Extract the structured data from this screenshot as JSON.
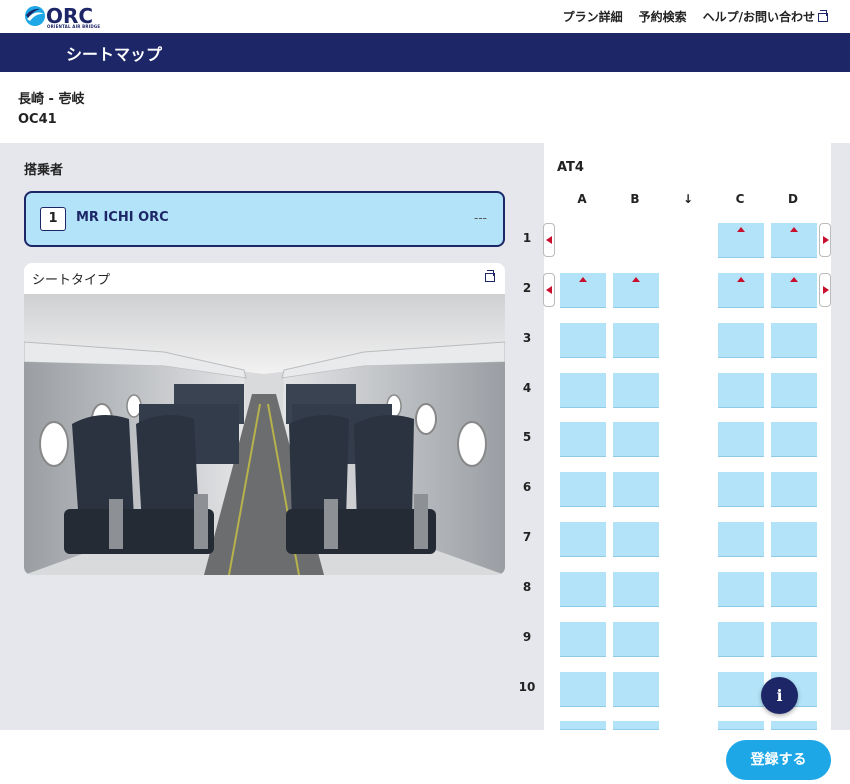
{
  "header": {
    "logo_text": "ORC",
    "logo_sub": "ORIENTAL AIR BRIDGE",
    "nav": [
      "プラン詳細",
      "予約検索",
      "ヘルプ/お問い合わせ"
    ]
  },
  "page": {
    "title": "シートマップ"
  },
  "route": {
    "segment": "長崎 - 壱岐",
    "flight": "OC41"
  },
  "passengers": {
    "title": "搭乗者",
    "list": [
      {
        "number": "1",
        "name": "MR ICHI ORC",
        "seat": "---"
      }
    ]
  },
  "seat_type": {
    "title": "シートタイプ",
    "image": "aircraft-cabin-photo"
  },
  "seatmap": {
    "aircraft": "AT4",
    "columns": [
      "A",
      "B",
      "↓",
      "C",
      "D"
    ],
    "rows": [
      "1",
      "2",
      "3",
      "4",
      "5",
      "6",
      "7",
      "8",
      "9",
      "10"
    ],
    "colors": {
      "available": "#b3e3f8",
      "restricted_marker": "#c8102e"
    }
  },
  "actions": {
    "register": "登録する",
    "info": "i"
  },
  "colors": {
    "brand": "#1d2768",
    "accent": "#1ea7e6"
  }
}
